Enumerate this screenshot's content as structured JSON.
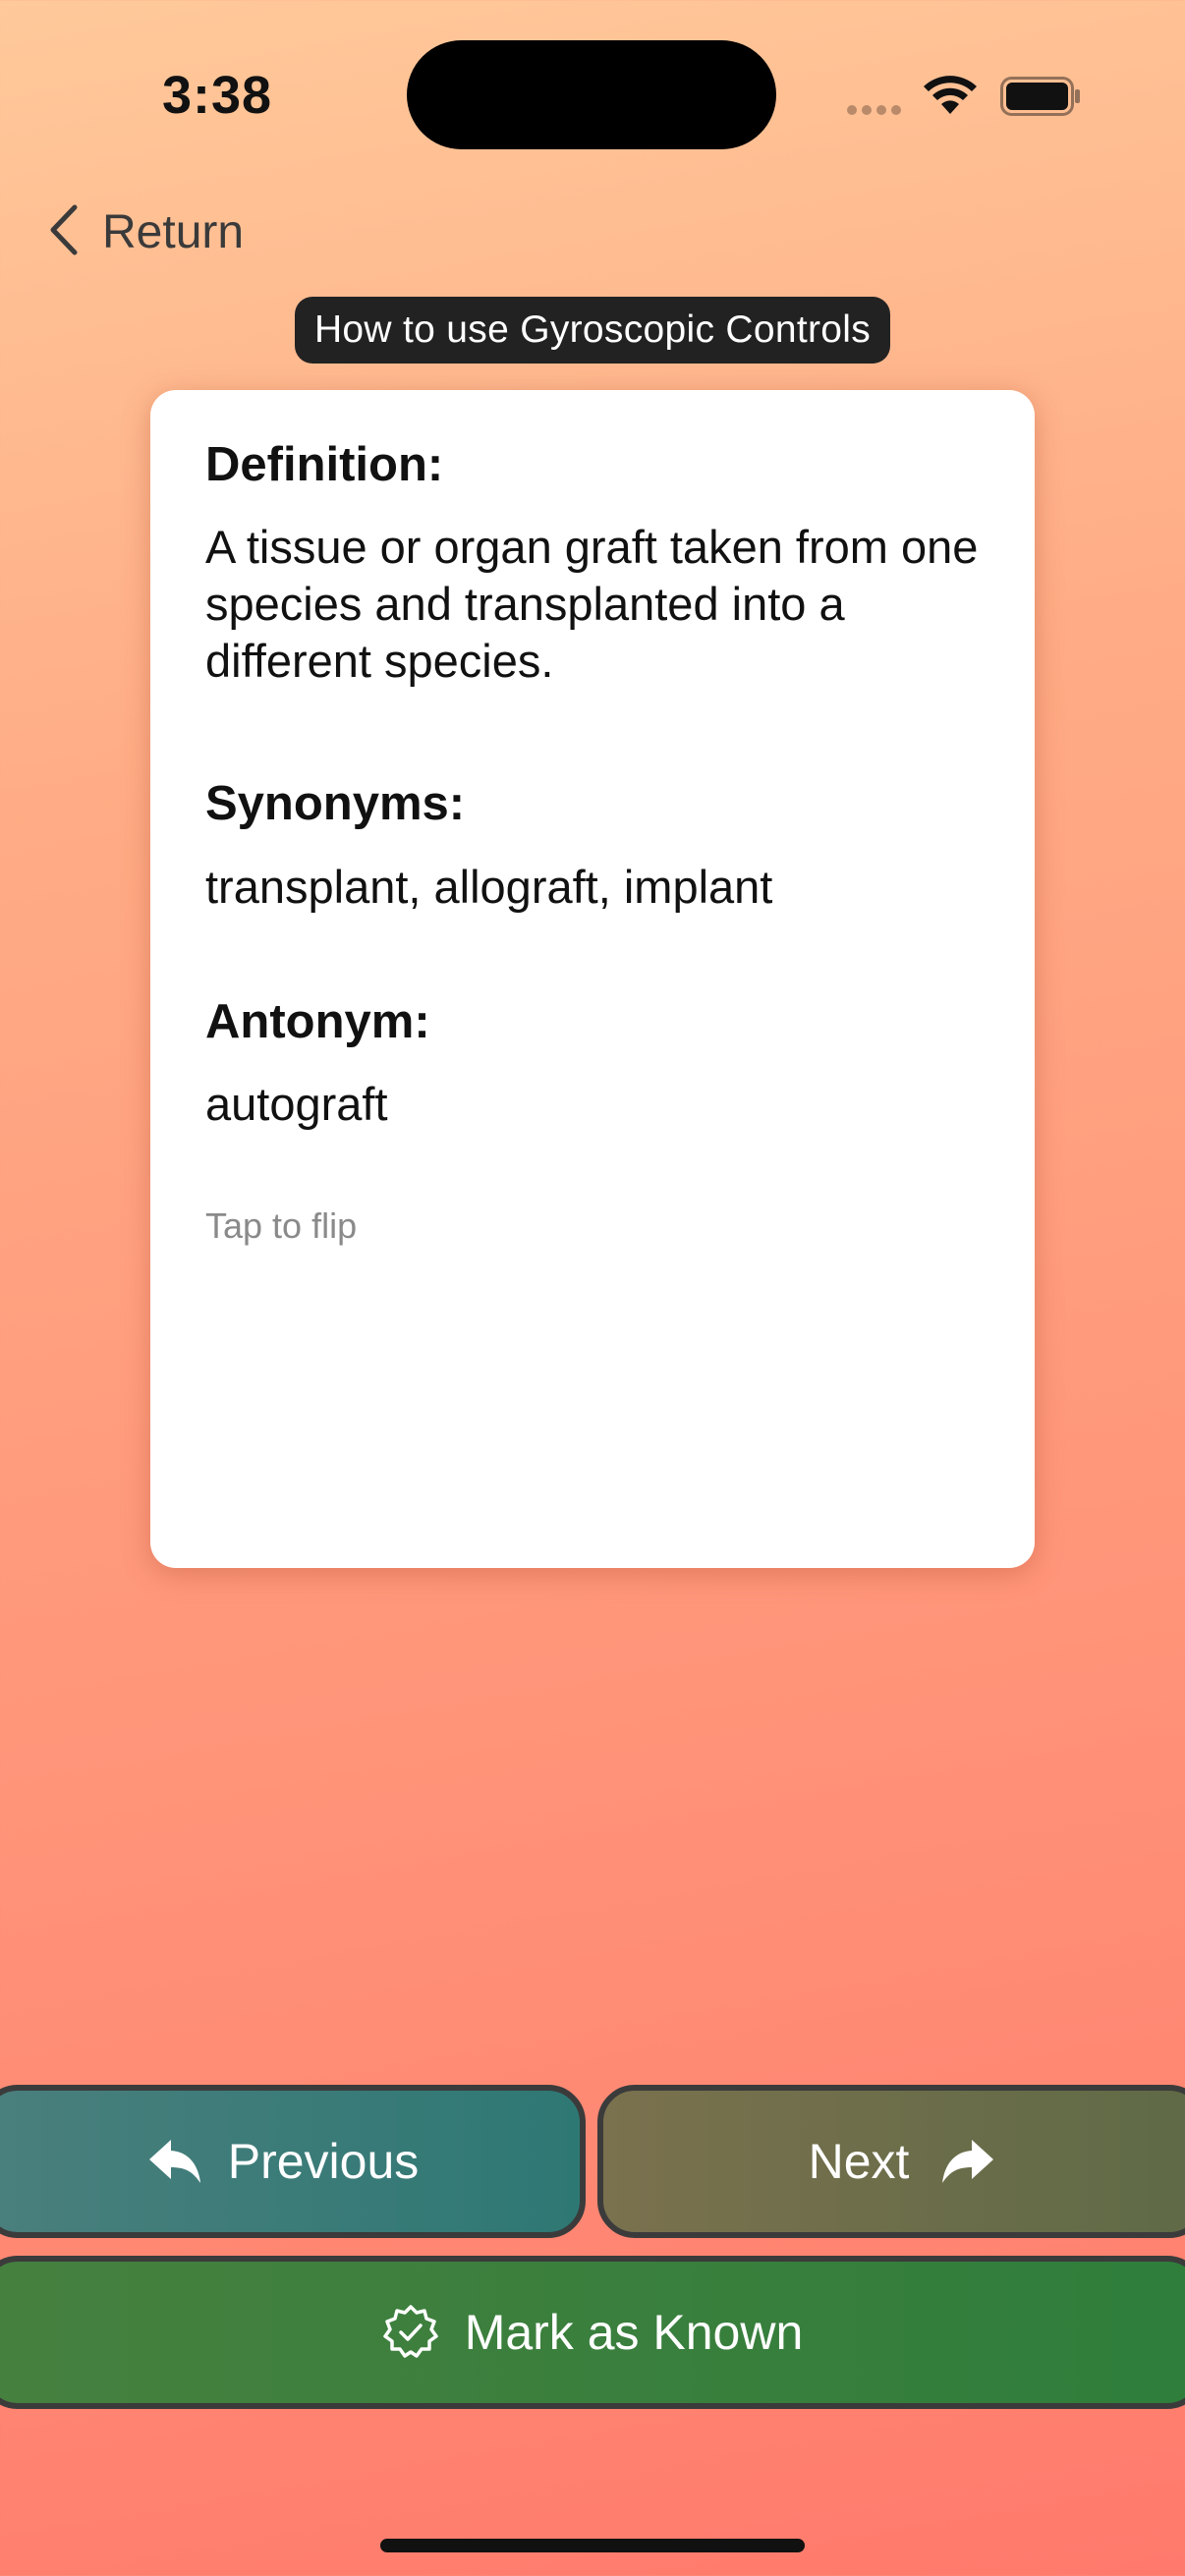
{
  "status_bar": {
    "time": "3:38",
    "icons": [
      "cellular-signal-icon",
      "wifi-icon",
      "battery-icon"
    ]
  },
  "nav": {
    "back_label": "Return",
    "back_icon": "chevron-left-icon"
  },
  "title": "How to use Gyroscopic Controls",
  "card": {
    "definition_heading": "Definition:",
    "definition_text": "A tissue or organ graft taken from one species and transplanted into a different species.",
    "synonyms_heading": "Synonyms:",
    "synonyms_text": "transplant, allograft, implant",
    "antonym_heading": "Antonym:",
    "antonym_text": "autograft",
    "hint": "Tap to flip"
  },
  "buttons": {
    "previous_label": "Previous",
    "previous_icon": "reply-arrow-icon",
    "next_label": "Next",
    "next_icon": "forward-arrow-icon",
    "known_label": "Mark as Known",
    "known_icon": "checkmark-seal-icon"
  },
  "colors": {
    "previous_button": "#2e7874",
    "next_button": "#6b6d4a",
    "known_button": "#34803c",
    "background_top": "#ffc99a",
    "background_bottom": "#ff7a6c"
  }
}
